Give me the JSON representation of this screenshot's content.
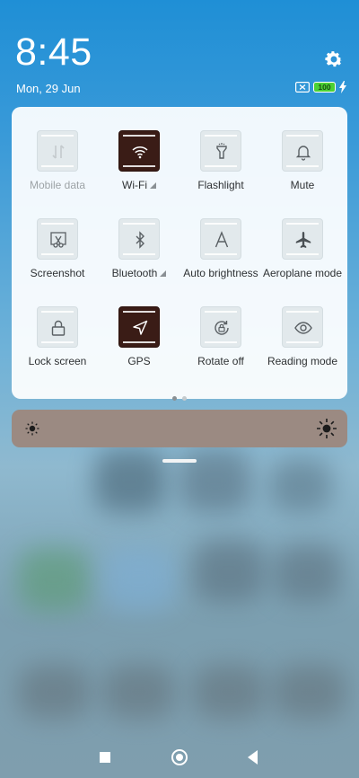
{
  "status": {
    "time": "8:45",
    "date": "Mon, 29 Jun",
    "battery": "100"
  },
  "icons": {
    "settings": "gear-icon",
    "sim": "no-sim-icon",
    "charge": "charging-bolt-icon"
  },
  "tiles": [
    {
      "label": "Mobile data",
      "icon": "mobile-data-icon",
      "on": false,
      "disabled": true
    },
    {
      "label": "Wi-Fi",
      "icon": "wifi-icon",
      "on": true,
      "expandable": true
    },
    {
      "label": "Flashlight",
      "icon": "flashlight-icon",
      "on": false
    },
    {
      "label": "Mute",
      "icon": "bell-icon",
      "on": false
    },
    {
      "label": "Screenshot",
      "icon": "scissors-icon",
      "on": false
    },
    {
      "label": "Bluetooth",
      "icon": "bluetooth-icon",
      "on": false,
      "expandable": true
    },
    {
      "label": "Auto brightness",
      "icon": "auto-brightness-icon",
      "on": false
    },
    {
      "label": "Aeroplane mode",
      "icon": "airplane-icon",
      "on": false
    },
    {
      "label": "Lock screen",
      "icon": "lock-icon",
      "on": false
    },
    {
      "label": "GPS",
      "icon": "gps-arrow-icon",
      "on": true
    },
    {
      "label": "Rotate off",
      "icon": "rotate-lock-icon",
      "on": false
    },
    {
      "label": "Reading mode",
      "icon": "eye-icon",
      "on": false
    }
  ],
  "pager": {
    "pages": 2,
    "current": 1
  },
  "brightness": {
    "icon_low": "sun-small-icon",
    "icon_high": "sun-large-icon"
  },
  "colors": {
    "active_tile": "#3a1c16",
    "battery_fill": "#4cd134"
  }
}
